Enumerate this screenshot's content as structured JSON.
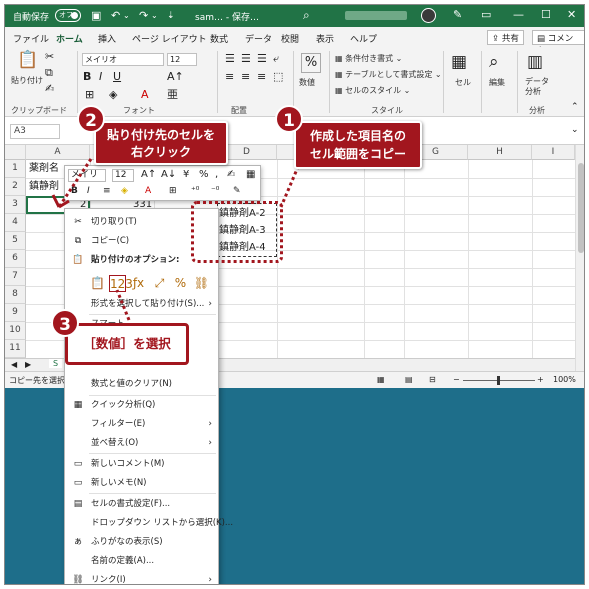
{
  "titlebar": {
    "autosave": "自動保存",
    "toggle": "オフ",
    "title": "sam… - 保存…",
    "bg": "#217346"
  },
  "tabs": [
    "ファイル",
    "ホーム",
    "挿入",
    "ページ レイアウト",
    "数式",
    "データ",
    "校閲",
    "表示",
    "ヘルプ"
  ],
  "share": "共有",
  "comment": "コメント",
  "ribbon": {
    "paste": "貼り付け",
    "font": "メイリオ",
    "size": "12",
    "percent": "%",
    "number": "数値",
    "cond": "条件付き書式",
    "table": "テーブルとして書式設定",
    "cellstyle": "セルのスタイル",
    "cell": "セル",
    "edit": "編集",
    "data": "データ分析",
    "analysis": "データ\n分析",
    "sections": {
      "clipboard": "クリップボード",
      "font": "フォント",
      "align": "配置",
      "style": "スタイル",
      "analysis": "分析"
    }
  },
  "namebox": "A3",
  "columns": [
    "A",
    "B",
    "C",
    "D",
    "E",
    "F",
    "G",
    "H",
    "I"
  ],
  "rows": [
    "1",
    "2",
    "3",
    "4",
    "5",
    "6",
    "7",
    "8",
    "9",
    "10",
    "11"
  ],
  "cells": {
    "a1": "薬剤名",
    "a2": "鎮静剤",
    "b3": "2",
    "c3": "331",
    "d2": "鎮静剤A-2",
    "d3": "鎮静剤A-3",
    "d4": "鎮静剤A-4"
  },
  "minitoolbar": {
    "font": "メイリ",
    "size": "12"
  },
  "context_menu": {
    "cut": "切り取り(T)",
    "copy": "コピー(C)",
    "paste_options": "貼り付けのオプション:",
    "paste_special": "形式を選択して貼り付け(S)...",
    "smart_lookup": "スマート…",
    "clear": "数式と値のクリア(N)",
    "quick": "クイック分析(Q)",
    "filter": "フィルター(E)",
    "sort": "並べ替え(O)",
    "new_comment": "新しいコメント(M)",
    "new_note": "新しいメモ(N)",
    "format_cells": "セルの書式設定(F)...",
    "dropdown": "ドロップダウン リストから選択(K)...",
    "furigana": "ふりがなの表示(S)",
    "define_name": "名前の定義(A)...",
    "link": "リンク(I)"
  },
  "status": {
    "left": "コピー先を選択",
    "zoom": "100%",
    "sheet": "S"
  },
  "callouts": {
    "c1_num": "1",
    "c1_text": "作成した項目名の\nセル範囲をコピー",
    "c2_num": "2",
    "c2_text": "貼り付け先のセルを\n右クリック",
    "c3_num": "3",
    "c3_text": "［数値］を選択",
    "accent": "#a2161e"
  }
}
